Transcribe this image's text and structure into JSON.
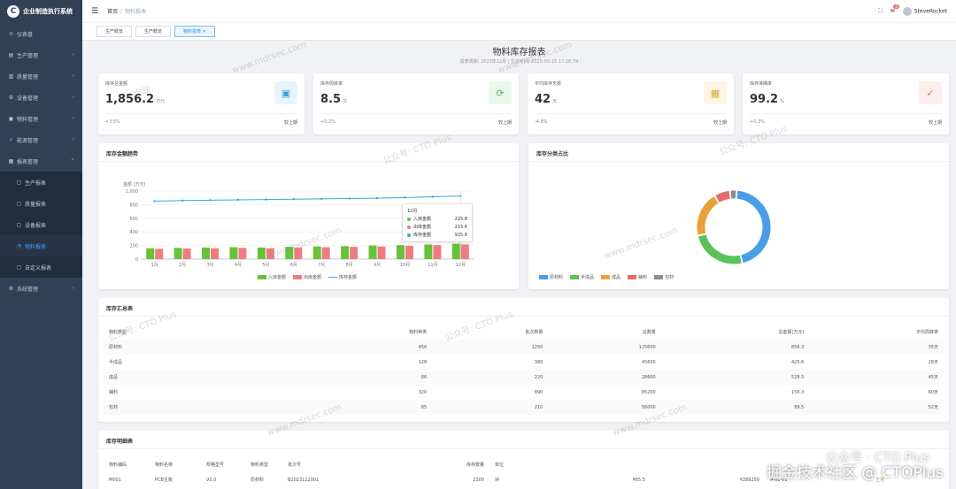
{
  "app": {
    "title": "企业制造执行系统",
    "logo_letter": "C"
  },
  "sidebar": {
    "items": [
      {
        "label": "仪表盘",
        "icon": "dashboard-icon"
      },
      {
        "label": "生产管理",
        "icon": "cart-icon"
      },
      {
        "label": "质量管理",
        "icon": "quality-icon"
      },
      {
        "label": "设备管理",
        "icon": "device-icon"
      },
      {
        "label": "物料管理",
        "icon": "box-icon"
      },
      {
        "label": "能源管理",
        "icon": "energy-icon"
      },
      {
        "label": "报表管理",
        "icon": "report-icon"
      }
    ],
    "sub": [
      {
        "label": "生产报表"
      },
      {
        "label": "质量报表"
      },
      {
        "label": "设备报表"
      },
      {
        "label": "物料报表"
      },
      {
        "label": "自定义报表"
      }
    ],
    "last": {
      "label": "系统管理",
      "icon": "settings-icon"
    }
  },
  "navbar": {
    "crumb_home": "首页",
    "crumb_current": "物料报表",
    "user": "SteveRocket",
    "badge": "3"
  },
  "tabs": [
    {
      "label": "生产概览"
    },
    {
      "label": "生产概览"
    },
    {
      "label": "物料报表"
    }
  ],
  "report": {
    "title": "物料库存报表",
    "subtitle": "报表周期: 2023年12月 | 生成时间: 2025-03-25 17:28:39"
  },
  "kpis": [
    {
      "label": "库存总金额",
      "value": "1,856.2",
      "unit": "万元",
      "change": "+3.5%",
      "compare": "较上期",
      "icon": "money-icon",
      "icon_bg": "#e8f4fb",
      "icon_color": "#36a3d9"
    },
    {
      "label": "库存周转率",
      "value": "8.5",
      "unit": "次",
      "change": "+5.2%",
      "compare": "较上期",
      "icon": "refresh-icon",
      "icon_bg": "#eaf7ec",
      "icon_color": "#4cb34c"
    },
    {
      "label": "平均库存天数",
      "value": "42",
      "unit": "天",
      "change": "-4.8%",
      "compare": "较上期",
      "icon": "calendar-icon",
      "icon_bg": "#fdf6e3",
      "icon_color": "#e0a83a"
    },
    {
      "label": "库存准确率",
      "value": "99.2",
      "unit": "%",
      "change": "+0.3%",
      "compare": "较上期",
      "icon": "check-icon",
      "icon_bg": "#fdeeee",
      "icon_color": "#e86a6a"
    }
  ],
  "trend": {
    "title": "库存金额趋势"
  },
  "pie": {
    "title": "库存分类占比"
  },
  "chart_data": [
    {
      "type": "bar",
      "title": "库存金额趋势",
      "ylabel": "金额 (万元)",
      "ylim": [
        0,
        1000
      ],
      "yticks": [
        "1,000",
        "800",
        "600",
        "400",
        "200",
        "0"
      ],
      "categories": [
        "1月",
        "2月",
        "3月",
        "4月",
        "5月",
        "6月",
        "7月",
        "8月",
        "9月",
        "10月",
        "11月",
        "12月"
      ],
      "series": [
        {
          "name": "入库金额",
          "type": "bar",
          "color": "#67c23a",
          "values": [
            160,
            165,
            170,
            175,
            170,
            180,
            185,
            190,
            200,
            205,
            215,
            225.8
          ]
        },
        {
          "name": "出库金额",
          "type": "bar",
          "color": "#f07c82",
          "values": [
            150,
            155,
            160,
            165,
            160,
            170,
            175,
            180,
            185,
            195,
            205,
            215.6
          ]
        },
        {
          "name": "库存金额",
          "type": "line",
          "color": "#3aa5d8",
          "values": [
            850,
            860,
            865,
            870,
            875,
            880,
            885,
            890,
            895,
            905,
            915,
            925.8
          ]
        }
      ],
      "tooltip": {
        "label": "12月",
        "rows": [
          {
            "name": "入库金额",
            "value": "225.8",
            "color": "#67c23a"
          },
          {
            "name": "出库金额",
            "value": "215.6",
            "color": "#f07c82"
          },
          {
            "name": "库存金额",
            "value": "925.8",
            "color": "#3aa5d8"
          }
        ]
      }
    },
    {
      "type": "pie",
      "title": "库存分类占比",
      "categories": [
        "原材料",
        "半成品",
        "成品",
        "辅料",
        "包材"
      ],
      "colors": [
        "#4a9ee8",
        "#5cc35a",
        "#e8a23a",
        "#e86a6a",
        "#8c8c8c"
      ],
      "values": [
        45,
        25,
        20,
        7,
        3
      ]
    }
  ],
  "summary": {
    "title": "库存汇总表",
    "headers": [
      "物料类型",
      "物料种类",
      "批次数量",
      "总数量",
      "总金额(万元)",
      "平均周转率"
    ],
    "rows": [
      [
        "原材料",
        "456",
        "1250",
        "125600",
        "856.3",
        "35天"
      ],
      [
        "半成品",
        "128",
        "380",
        "45600",
        "425.6",
        "28天"
      ],
      [
        "成品",
        "86",
        "220",
        "28600",
        "528.5",
        "45天"
      ],
      [
        "辅料",
        "320",
        "890",
        "85200",
        "156.3",
        "60天"
      ],
      [
        "包材",
        "85",
        "210",
        "56000",
        "89.5",
        "52天"
      ]
    ]
  },
  "detail": {
    "title": "库存明细表",
    "headers": [
      "物料编码",
      "物料名称",
      "规格型号",
      "物料类型",
      "批次号",
      "库存数量",
      "单位",
      "",
      "",
      "",
      ""
    ],
    "rows": [
      [
        "M001",
        "PCB主板",
        "V2.0",
        "原材料",
        "B2023112001",
        "2300",
        "块",
        "¥65.5",
        "¥289250",
        "A-01-01",
        "正常"
      ]
    ]
  },
  "watermark": {
    "site": "www.mdrsec.com",
    "official": "官网:",
    "public": "公众号: CTO Plus",
    "corner1": "公众号 · CTO Plus",
    "corner2": "掘金技术社区 @ CTOPlus"
  }
}
